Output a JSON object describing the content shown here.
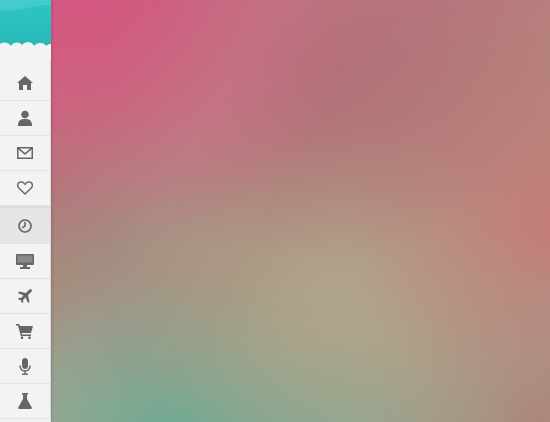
{
  "sidebar": {
    "accent_color": "#2cc6c4",
    "icon_color": "#6b6b6b",
    "items": [
      {
        "icon": "home-icon",
        "id": "home"
      },
      {
        "icon": "user-icon",
        "id": "profile"
      },
      {
        "icon": "mail-icon",
        "id": "messages"
      },
      {
        "icon": "heart-icon",
        "id": "favorites"
      },
      {
        "icon": "clock-icon",
        "id": "history"
      },
      {
        "icon": "monitor-icon",
        "id": "desktop"
      },
      {
        "icon": "plane-icon",
        "id": "travel"
      },
      {
        "icon": "cart-icon",
        "id": "cart"
      },
      {
        "icon": "microphone-icon",
        "id": "audio"
      },
      {
        "icon": "flask-icon",
        "id": "lab"
      }
    ]
  }
}
